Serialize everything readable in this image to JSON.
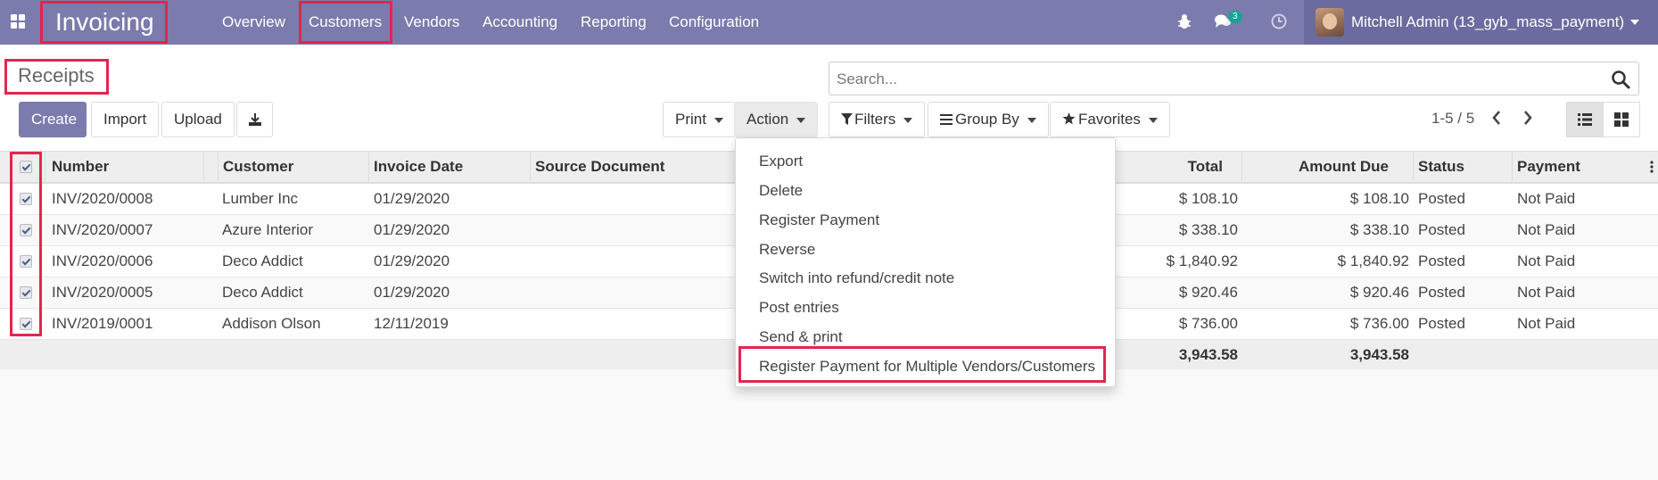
{
  "navbar": {
    "brand": "Invoicing",
    "menu": [
      {
        "label": "Overview"
      },
      {
        "label": "Customers"
      },
      {
        "label": "Vendors"
      },
      {
        "label": "Accounting"
      },
      {
        "label": "Reporting"
      },
      {
        "label": "Configuration"
      }
    ],
    "messages_count": "3",
    "user": "Mitchell Admin (13_gyb_mass_payment)"
  },
  "breadcrumb": "Receipts",
  "search": {
    "placeholder": "Search..."
  },
  "toolbar": {
    "create": "Create",
    "import": "Import",
    "upload": "Upload",
    "print": "Print",
    "action": "Action",
    "filters": "Filters",
    "group_by": "Group By",
    "favorites": "Favorites",
    "pager": "1-5 / 5"
  },
  "table": {
    "headers": {
      "number": "Number",
      "customer": "Customer",
      "invoice_date": "Invoice Date",
      "source_document": "Source Document",
      "total": "Total",
      "amount_due": "Amount Due",
      "status": "Status",
      "payment": "Payment"
    },
    "rows": [
      {
        "number": "INV/2020/0008",
        "customer": "Lumber Inc",
        "date": "01/29/2020",
        "total": "$ 108.10",
        "due": "$ 108.10",
        "status": "Posted",
        "payment": "Not Paid"
      },
      {
        "number": "INV/2020/0007",
        "customer": "Azure Interior",
        "date": "01/29/2020",
        "total": "$ 338.10",
        "due": "$ 338.10",
        "status": "Posted",
        "payment": "Not Paid"
      },
      {
        "number": "INV/2020/0006",
        "customer": "Deco Addict",
        "date": "01/29/2020",
        "total": "$ 1,840.92",
        "due": "$ 1,840.92",
        "status": "Posted",
        "payment": "Not Paid"
      },
      {
        "number": "INV/2020/0005",
        "customer": "Deco Addict",
        "date": "01/29/2020",
        "total": "$ 920.46",
        "due": "$ 920.46",
        "status": "Posted",
        "payment": "Not Paid"
      },
      {
        "number": "INV/2019/0001",
        "customer": "Addison Olson",
        "date": "12/11/2019",
        "total": "$ 736.00",
        "due": "$ 736.00",
        "status": "Posted",
        "payment": "Not Paid"
      }
    ],
    "totals": {
      "total": "3,943.58",
      "due": "3,943.58"
    }
  },
  "action_menu": [
    "Export",
    "Delete",
    "Register Payment",
    "Reverse",
    "Switch into refund/credit note",
    "Post entries",
    "Send & print",
    "Register Payment for Multiple Vendors/Customers"
  ],
  "colors": {
    "brand": "#7c7bad",
    "highlight": "#e0274e",
    "badge": "#1aa394"
  }
}
